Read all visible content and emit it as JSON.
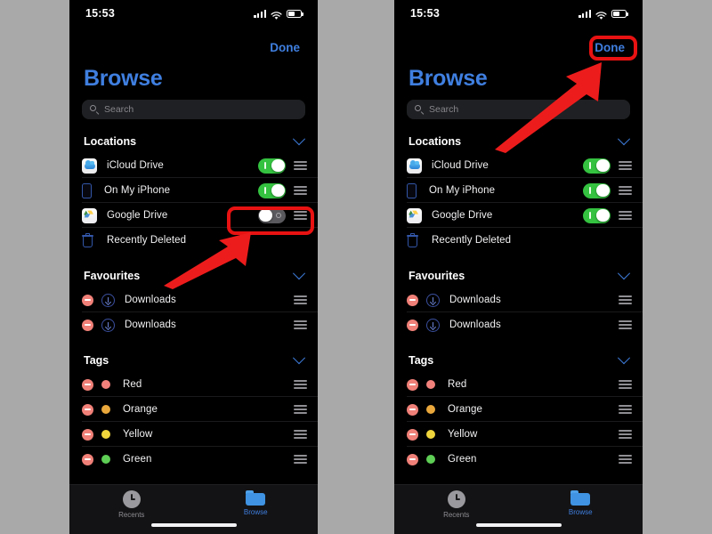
{
  "background_color": "#a9a9a9",
  "accent_color": "#3f7fe0",
  "highlight_color": "#e81212",
  "toggle_on_color": "#34c240",
  "toggle_off_color": "#5a5a5e",
  "status_bar": {
    "time": "15:53",
    "signal_icon": "cellular-signal-icon",
    "wifi_icon": "wifi-icon",
    "battery_icon": "battery-icon"
  },
  "nav": {
    "done_label": "Done"
  },
  "header": {
    "title": "Browse"
  },
  "search": {
    "placeholder": "Search",
    "value": "",
    "icon": "search-icon"
  },
  "sections": [
    {
      "id": "locations",
      "title": "Locations",
      "collapse_icon": "chevron-down-icon",
      "rows": [
        {
          "label": "iCloud Drive",
          "icon": "icloud-drive-icon",
          "toggle_left": "on",
          "toggle_right": "on",
          "grip": "reorder-handle-icon"
        },
        {
          "label": "On My iPhone",
          "icon": "iphone-icon",
          "toggle_left": "on",
          "toggle_right": "on",
          "grip": "reorder-handle-icon"
        },
        {
          "label": "Google Drive",
          "icon": "google-drive-icon",
          "toggle_left": "off",
          "toggle_right": "on",
          "grip": "reorder-handle-icon"
        },
        {
          "label": "Recently Deleted",
          "icon": "trash-icon",
          "toggle_left": null,
          "toggle_right": null,
          "grip": null
        }
      ]
    },
    {
      "id": "favourites",
      "title": "Favourites",
      "collapse_icon": "chevron-down-icon",
      "rows": [
        {
          "label": "Downloads",
          "icon": "download-circle-icon",
          "remove": "remove-minus-icon",
          "grip": "reorder-handle-icon"
        },
        {
          "label": "Downloads",
          "icon": "download-circle-icon",
          "remove": "remove-minus-icon",
          "grip": "reorder-handle-icon"
        }
      ]
    },
    {
      "id": "tags",
      "title": "Tags",
      "collapse_icon": "chevron-down-icon",
      "rows": [
        {
          "label": "Red",
          "dot_color": "#f2817c",
          "remove": "remove-minus-icon",
          "grip": "reorder-handle-icon"
        },
        {
          "label": "Orange",
          "dot_color": "#eaa83c",
          "remove": "remove-minus-icon",
          "grip": "reorder-handle-icon"
        },
        {
          "label": "Yellow",
          "dot_color": "#f0d63c",
          "remove": "remove-minus-icon",
          "grip": "reorder-handle-icon"
        },
        {
          "label": "Green",
          "dot_color": "#5ece55",
          "remove": "remove-minus-icon",
          "grip": "reorder-handle-icon"
        }
      ]
    }
  ],
  "tabbar": {
    "tabs": [
      {
        "label": "Recents",
        "icon": "clock-icon",
        "active": false
      },
      {
        "label": "Browse",
        "icon": "folder-icon",
        "active": true
      }
    ]
  },
  "annotations": {
    "left_panel": {
      "highlight_target": "google-drive-toggle",
      "arrow": "arrow-up-right"
    },
    "right_panel": {
      "highlight_target": "done-button",
      "arrow": "arrow-up-right"
    }
  }
}
